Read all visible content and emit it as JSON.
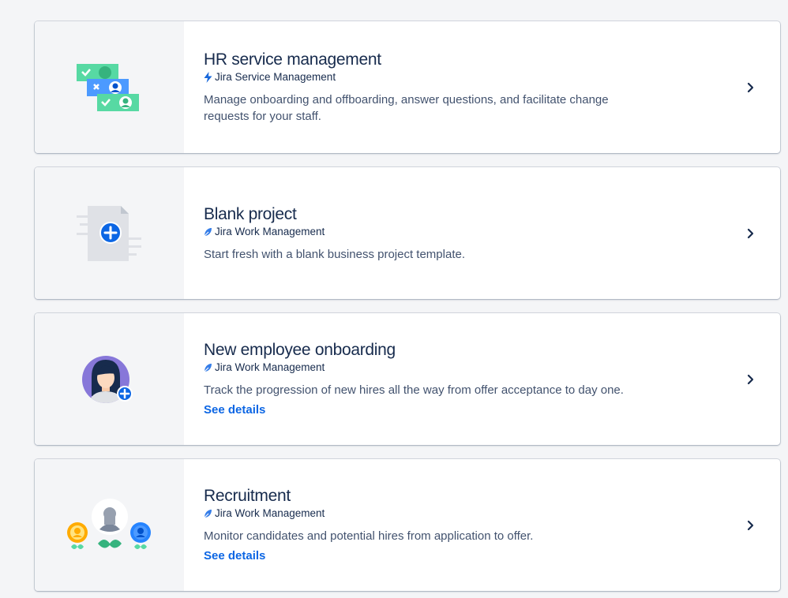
{
  "templates": [
    {
      "title": "HR service management",
      "product": "Jira Service Management",
      "product_icon": "jira-service-management-bolt-icon",
      "description": "Manage onboarding and offboarding, answer questions, and facilitate change requests for your staff.",
      "illustration": "hr-service-illustration-icon",
      "link": ""
    },
    {
      "title": "Blank project",
      "product": "Jira Work Management",
      "product_icon": "jira-work-management-icon",
      "description": "Start fresh with a blank business project template.",
      "illustration": "blank-project-illustration-icon",
      "link": ""
    },
    {
      "title": "New employee onboarding",
      "product": "Jira Work Management",
      "product_icon": "jira-work-management-icon",
      "description": "Track the progression of new hires all the way from offer acceptance to day one.",
      "illustration": "employee-onboarding-avatar-icon",
      "link": "See details"
    },
    {
      "title": "Recruitment",
      "product": "Jira Work Management",
      "product_icon": "jira-work-management-icon",
      "description": "Monitor candidates and potential hires from application to offer.",
      "illustration": "recruitment-illustration-icon",
      "link": "See details"
    }
  ],
  "colors": {
    "title": "#172b4d",
    "text": "#42526e",
    "link": "#0c66e4",
    "jsm_bolt": "#1868db",
    "jwm_leaf": "#357de8",
    "image_panel": "#f4f5f7"
  }
}
